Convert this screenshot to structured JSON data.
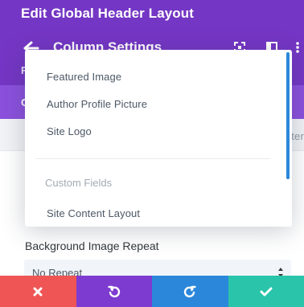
{
  "header": {
    "title": "Edit Global Header Layout",
    "column_title": "Column Settings",
    "bg": "#7436c4",
    "tab_bg": "#8b50dc",
    "sub_label": "R",
    "tab_label": "C"
  },
  "filterbar": {
    "text": "ter"
  },
  "dropdown": {
    "items": [
      "Featured Image",
      "Author Profile Picture",
      "Site Logo"
    ],
    "group_label": "Custom Fields",
    "group_items": [
      "Site Content Layout"
    ],
    "scrollbar_color": "#2b87da"
  },
  "settings": {
    "background_repeat": {
      "label": "Background Image Repeat",
      "value": "No Repeat"
    }
  },
  "actions": [
    {
      "name": "cancel",
      "icon": "close-icon",
      "color": "#ef5555"
    },
    {
      "name": "undo",
      "icon": "undo-icon",
      "color": "#7e3bd0"
    },
    {
      "name": "redo",
      "icon": "redo-icon",
      "color": "#2b87da"
    },
    {
      "name": "save",
      "icon": "check-icon",
      "color": "#29c4a9"
    }
  ]
}
